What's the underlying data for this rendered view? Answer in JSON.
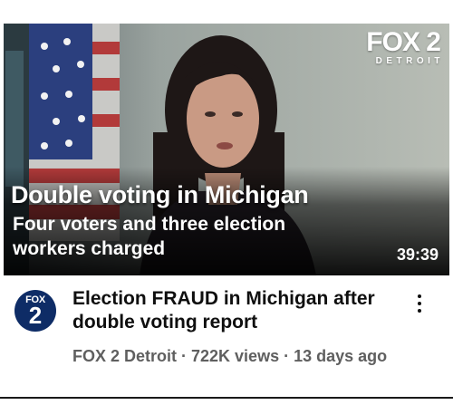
{
  "video": {
    "thumbnail": {
      "logo_main": "FOX 2",
      "logo_sub": "DETROIT",
      "headline": "Double voting in Michigan",
      "subheadline": "Four voters and three election workers charged",
      "duration": "39:39"
    },
    "channel_avatar": {
      "line1": "FOX",
      "line2": "2"
    },
    "title": "Election FRAUD in Michigan after double voting report",
    "meta": "FOX 2 Detroit · 722K views · 13 days ago",
    "menu_icon": "more-vert-icon"
  },
  "colors": {
    "avatar_bg": "#0e2c66",
    "title": "#0f0f0f",
    "meta": "#5f5f5f"
  }
}
